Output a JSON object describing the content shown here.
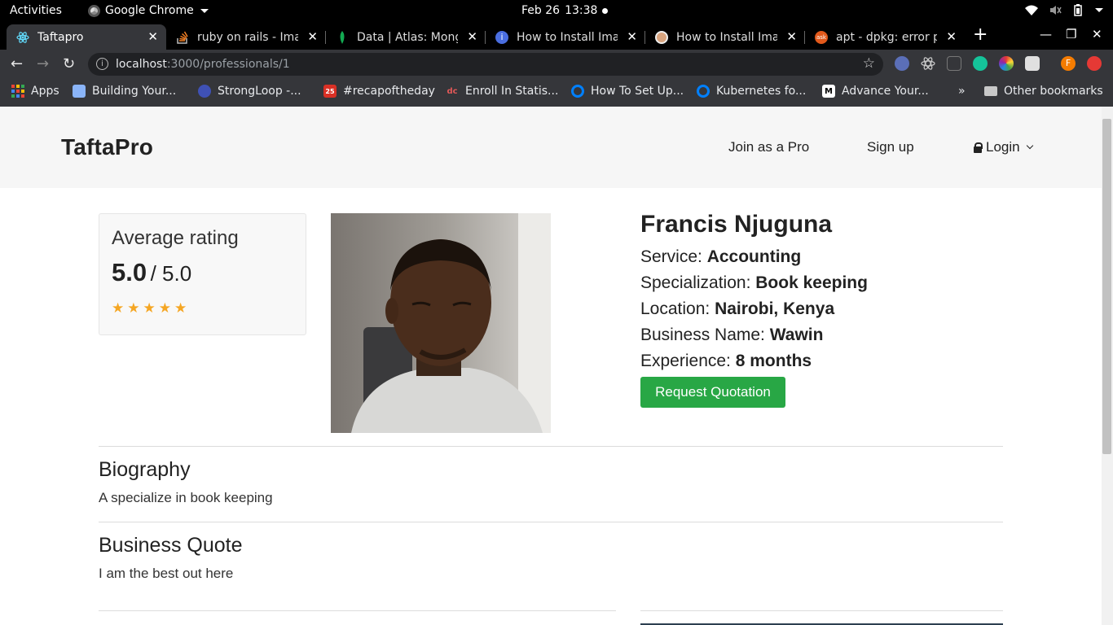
{
  "system_bar": {
    "activities": "Activities",
    "app_name": "Google Chrome",
    "date": "Feb 26",
    "time": "13:38"
  },
  "tabs": [
    {
      "title": "Taftapro",
      "active": true,
      "icon_color": "#61dafb",
      "icon": "react-icon"
    },
    {
      "title": "ruby on rails - Image",
      "active": false,
      "icon_color": "#f48024",
      "icon": "stackoverflow-icon"
    },
    {
      "title": "Data | Atlas: MongoDB",
      "active": false,
      "icon_color": "#13aa52",
      "icon": "mongodb-leaf-icon"
    },
    {
      "title": "How to Install Image",
      "active": false,
      "icon_color": "#4a6ee0",
      "icon": "info-icon"
    },
    {
      "title": "How to Install Image",
      "active": false,
      "icon_color": "#d8a47f",
      "icon": "avatar-icon"
    },
    {
      "title": "apt - dpkg: error pr",
      "active": false,
      "icon_color": "#e2591b",
      "icon": "askubuntu-icon"
    }
  ],
  "omnibox": {
    "host": "localhost",
    "path": ":3000/professionals/1"
  },
  "bookmarks": [
    {
      "label": "Apps",
      "icon": "apps-grid-icon"
    },
    {
      "label": "Building Your...",
      "icon": "building-icon",
      "color": "#8ab4f8"
    },
    {
      "label": "StrongLoop -...",
      "icon": "strongloop-icon",
      "color": "#3f51b5"
    },
    {
      "label": "#recapoftheday",
      "icon": "calendar-icon",
      "color": "#d93025"
    },
    {
      "label": "Enroll In Statis...",
      "icon": "datacamp-icon",
      "color": "#e25858"
    },
    {
      "label": "How To Set Up...",
      "icon": "digitalocean-icon",
      "color": "#0080ff"
    },
    {
      "label": "Kubernetes fo...",
      "icon": "digitalocean-icon",
      "color": "#0080ff"
    },
    {
      "label": "Advance Your...",
      "icon": "medium-icon",
      "color": "#000000"
    },
    {
      "label": "Other bookmarks",
      "icon": "folder-icon"
    }
  ],
  "site": {
    "brand": "TaftaPro",
    "nav": {
      "join": "Join as a Pro",
      "signup": "Sign up",
      "login": "Login"
    }
  },
  "rating": {
    "title": "Average rating",
    "value": "5.0",
    "max": "/ 5.0",
    "stars": 5
  },
  "professional": {
    "name": "Francis Njuguna",
    "fields": [
      {
        "label": "Service: ",
        "value": "Accounting"
      },
      {
        "label": "Specialization: ",
        "value": "Book keeping"
      },
      {
        "label": "Location: ",
        "value": "Nairobi, Kenya"
      },
      {
        "label": "Business Name: ",
        "value": "Wawin"
      },
      {
        "label": "Experience: ",
        "value": "8 months"
      }
    ],
    "quote_button": "Request Quotation"
  },
  "biography": {
    "title": "Biography",
    "text": "A specialize in book keeping"
  },
  "business_quote": {
    "title": "Business Quote",
    "text": "I am the best out here"
  },
  "colors": {
    "accent_green": "#28a745",
    "star": "#f5a623",
    "chrome_dark": "#35363a"
  }
}
